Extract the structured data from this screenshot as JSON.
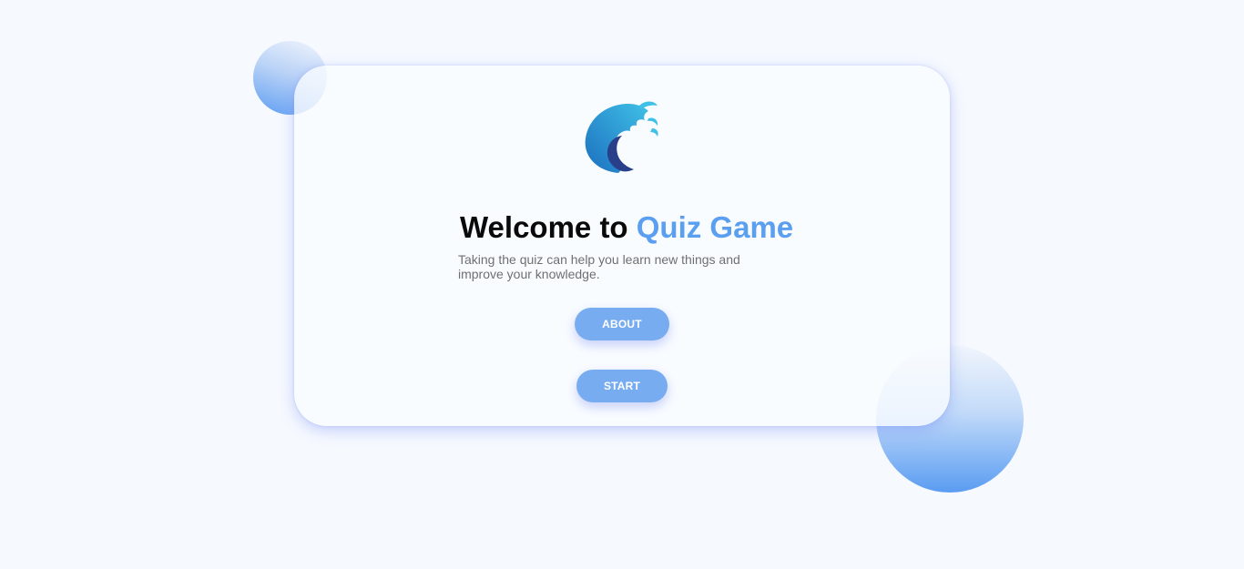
{
  "header": {
    "title_prefix": "Welcome to",
    "title_highlight": "Quiz Game",
    "subtitle": "Taking the quiz can help you learn new things and improve your knowledge."
  },
  "buttons": {
    "about_label": "ABOUT",
    "start_label": "START"
  },
  "colors": {
    "page_background": "#f6f9fe",
    "accent": "#5b9ff0",
    "button": "#78acf1",
    "card_glow": "#748af6"
  },
  "icons": {
    "logo": "wave-icon"
  }
}
